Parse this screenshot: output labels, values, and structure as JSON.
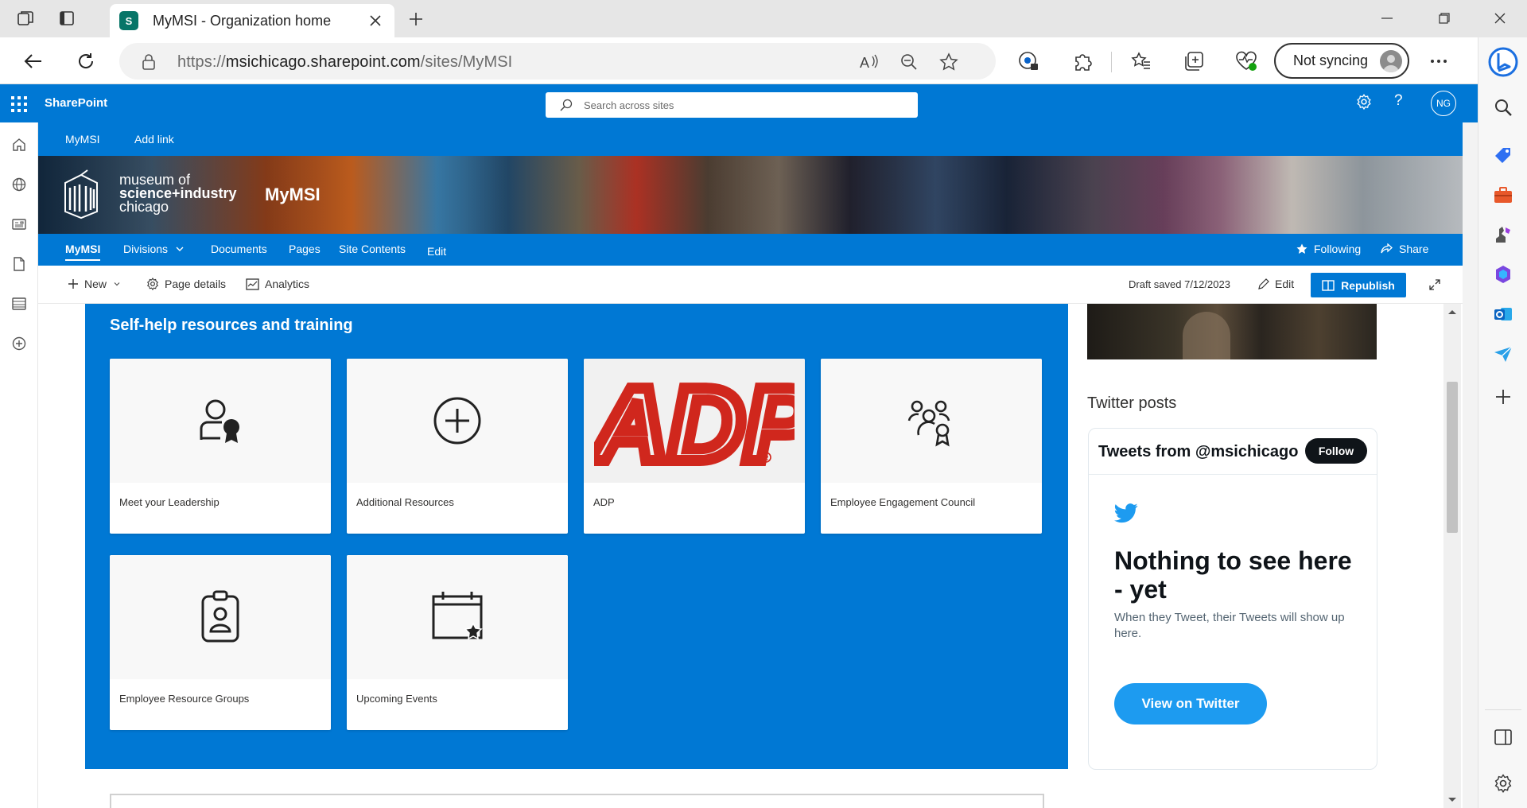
{
  "browser": {
    "tab_title": "MyMSI - Organization home",
    "tab_favicon_letter": "S",
    "url": {
      "scheme": "https://",
      "host": "msichicago.sharepoint.com",
      "path": "/sites/MyMSI"
    },
    "sync_label": "Not syncing"
  },
  "suitebar": {
    "brand": "SharePoint",
    "search_placeholder": "Search across sites",
    "user_initials": "NG"
  },
  "hubnav": {
    "items": [
      "MyMSI",
      "Add link"
    ]
  },
  "banner": {
    "logo_line1": "museum of",
    "logo_line2": "science+industry",
    "logo_line3": "chicago",
    "site_title": "MyMSI"
  },
  "sitenav": {
    "items": [
      "MyMSI",
      "Divisions",
      "Documents",
      "Pages",
      "Site Contents",
      "Edit"
    ],
    "following_label": "Following",
    "share_label": "Share"
  },
  "cmdbar": {
    "new_label": "New",
    "page_details_label": "Page details",
    "analytics_label": "Analytics",
    "draft_status": "Draft saved 7/12/2023",
    "edit_label": "Edit",
    "republish_label": "Republish"
  },
  "section": {
    "title": "Self-help resources and training",
    "tiles": [
      {
        "label": "Meet your Leadership",
        "icon": "person-ribbon-icon"
      },
      {
        "label": "Additional Resources",
        "icon": "add-circle-icon"
      },
      {
        "label": "ADP",
        "icon": "adp-logo"
      },
      {
        "label": "Employee Engagement Council",
        "icon": "people-award-icon"
      },
      {
        "label": "Employee Resource Groups",
        "icon": "badge-person-icon"
      },
      {
        "label": "Upcoming Events",
        "icon": "calendar-star-icon"
      }
    ]
  },
  "adp_logo_text": "ADP",
  "twitter": {
    "heading": "Twitter posts",
    "header_title": "Tweets from @msichicago",
    "follow_label": "Follow",
    "empty_title": "Nothing to see here - yet",
    "empty_subtitle": "When they Tweet, their Tweets will show up here.",
    "view_button": "View on Twitter"
  },
  "colors": {
    "sharepoint_blue": "#0078d4",
    "adp_red": "#d0271d",
    "twitter_blue": "#1d9bf0"
  }
}
